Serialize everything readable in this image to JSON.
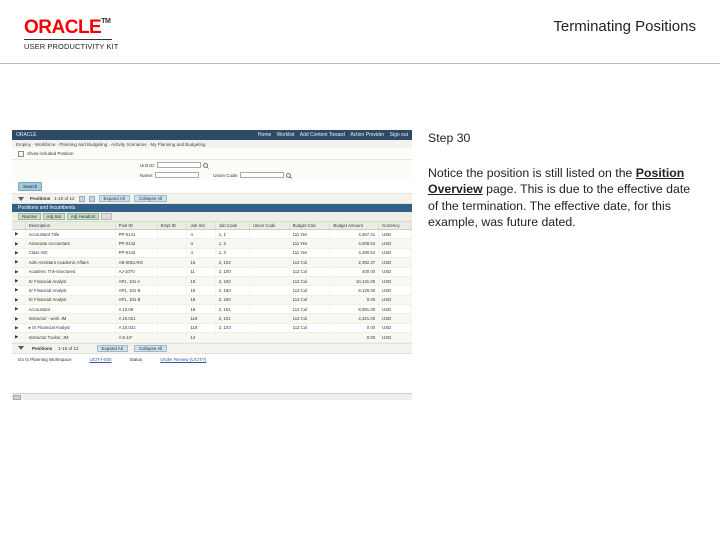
{
  "header": {
    "brand": "ORACLE",
    "tm": "TM",
    "product": "USER PRODUCTIVITY KIT",
    "title": "Terminating Positions"
  },
  "step": {
    "label": "Step 30"
  },
  "instruction": {
    "pre": "Notice the position is still listed on the ",
    "bold_ul": "Position Overview",
    "post": " page. This is due to the effective date of the termination. The effective date, for this example, was future dated."
  },
  "thumb": {
    "topbar": {
      "brand": "ORACLE",
      "links": [
        "Home",
        "Worklist",
        "Add Content Toward",
        "Action Provider",
        "Sign out"
      ]
    },
    "breadcrumb": "Employ · Workforce · Planning and Budgeting · Activity Scenarios · My Planning and Budgeting",
    "unit_label": "Show included Position",
    "filters": {
      "unitid_label": "Unit ID:",
      "name_label": "Name:",
      "unionc_label": "Union Code:"
    },
    "search_btn": "Search",
    "positions_bar": {
      "left": "Positions",
      "range": "1-10 of 12",
      "expand": "Expand All",
      "collapse": "Collapse All"
    },
    "band": "Positions and Incumbents",
    "toolbar2": [
      "Narrow",
      "Adj Sal",
      "Adj Headcnt",
      ""
    ],
    "columns": [
      "",
      "Description",
      "Pool ID",
      "Empl ID",
      "Job Ind",
      "Job Code",
      "Union Code",
      "Budget Calc",
      "Budget Amount",
      "Currency"
    ],
    "rows": [
      [
        "▶",
        "Accountant Title",
        "PP-0141",
        "",
        "4",
        "1, 1",
        "",
        "111 Yes",
        "4,357.41",
        "USD"
      ],
      [
        "▶",
        "Associate Accountant",
        "PP-0142",
        "",
        "4",
        "1, 2",
        "",
        "111 Yes",
        "4,009.54",
        "USD"
      ],
      [
        "▶",
        "Class AID",
        "PP-0143",
        "",
        "4",
        "1, 3",
        "",
        "111 Yes",
        "4,290.54",
        "USD"
      ],
      [
        "▶",
        "Adm Assistant Academic Affairs",
        "AB-0051.RG",
        "",
        "16",
        "2, 102",
        "",
        "112 Col",
        "2,392.37",
        "USD"
      ],
      [
        "▶",
        "Academc Tnk-structured",
        "AJ-1070",
        "",
        "11",
        "2, 100",
        "",
        "112 Col",
        "400.00",
        "USD"
      ],
      [
        "▶",
        "Sr Financial Analyst",
        "AP1, 101 A",
        "",
        "18",
        "2, 150",
        "",
        "112 Col",
        "10,131.00",
        "USD"
      ],
      [
        "▶",
        "Sr Financial Analyst",
        "AP1, 101 B",
        "",
        "18",
        "2, 150",
        "",
        "112 Col",
        "9,125.00",
        "USD"
      ],
      [
        "▶",
        "Sr Financial Analyst",
        "AP1, 101 B",
        "",
        "18",
        "2, 150",
        "",
        "112 Col",
        "0.00",
        "USD"
      ],
      [
        "▶",
        "Accountant",
        "A  10.08",
        "",
        "18",
        "2, 151",
        "",
        "112 Col",
        "8,081.00",
        "USD"
      ],
      [
        "▶",
        "Instructor - work JM",
        "A  10.021",
        "",
        "118",
        "2, 101",
        "",
        "112 Col",
        "4,321.00",
        "USD"
      ],
      [
        "▶",
        "▸ Sr Financial Analyst",
        "A  10.021",
        "",
        "118",
        "2, 103",
        "",
        "112 Col",
        "0.00",
        "USD"
      ],
      [
        "▶",
        "Instructor Tucker, JM",
        "A   9.14*",
        "",
        "14",
        "",
        "",
        "",
        "0.00",
        "USD"
      ]
    ],
    "positions_bar2": {
      "left": "Positions",
      "range": "1-10 of 12",
      "expand": "Expand All",
      "collapse": "Collapse All"
    },
    "footer": {
      "label": "Go to Planning Workspace",
      "link1": "UCITY-000",
      "status": "Status",
      "link2": "Under Review (UCITY)"
    }
  }
}
